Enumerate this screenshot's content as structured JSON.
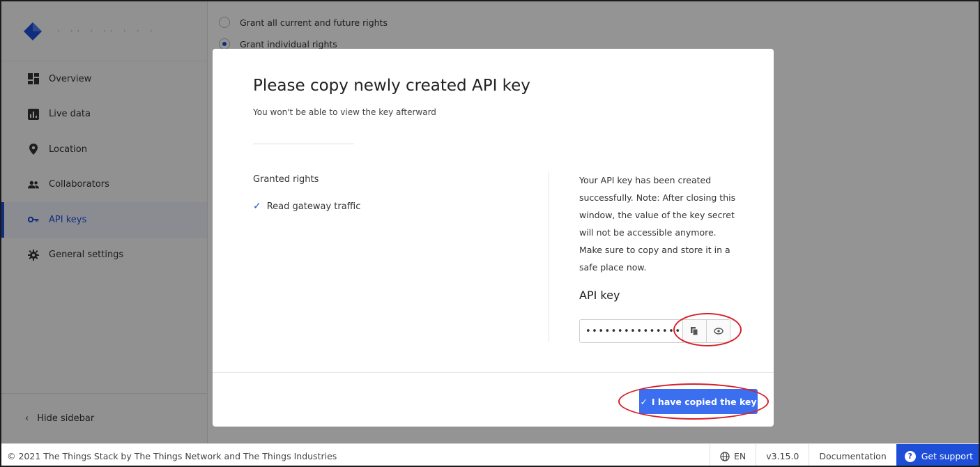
{
  "sidebar": {
    "brand_text": "· ·· · ·· · · ·",
    "items": [
      {
        "label": "Overview",
        "icon": "overview-icon"
      },
      {
        "label": "Live data",
        "icon": "live-data-icon"
      },
      {
        "label": "Location",
        "icon": "location-pin-icon"
      },
      {
        "label": "Collaborators",
        "icon": "people-icon"
      },
      {
        "label": "API keys",
        "icon": "key-icon",
        "active": true
      },
      {
        "label": "General settings",
        "icon": "gear-icon"
      }
    ],
    "hide_label": "Hide sidebar"
  },
  "background": {
    "radio_all": "Grant all current and future rights",
    "radio_individual": "Grant individual rights"
  },
  "modal": {
    "title": "Please copy newly created API key",
    "subtitle": "You won't be able to view the key afterward",
    "granted_heading": "Granted rights",
    "granted_item": "Read gateway traffic",
    "info": "Your API key has been created successfully. Note: After closing this window, the value of the key secret will not be accessible anymore. Make sure to copy and store it in a safe place now.",
    "key_label": "API key",
    "key_value": "•••••••••••••••",
    "copied_button": "I have copied the key"
  },
  "footer": {
    "copyright": "© 2021 The Things Stack by The Things Network and The Things Industries",
    "language": "EN",
    "version": "v3.15.0",
    "documentation": "Documentation",
    "support": "Get support"
  },
  "colors": {
    "accent": "#1e4ed8",
    "button": "#3b6ff0",
    "annotation": "#d81e28"
  }
}
